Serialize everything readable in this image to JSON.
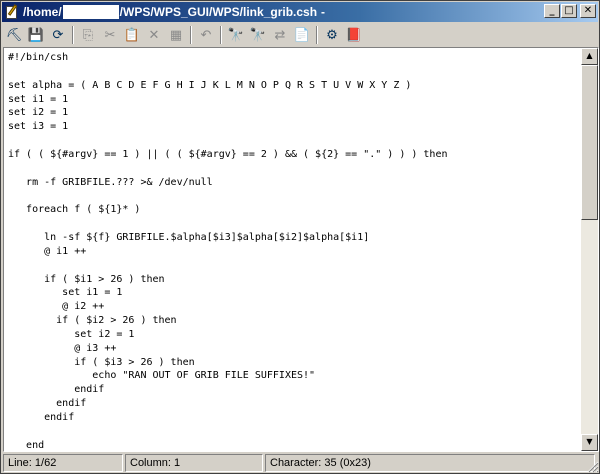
{
  "window": {
    "title_prefix": "/home/",
    "title_suffix": "/WPS/WPS_GUI/WPS/link_grib.csh",
    "title_tail": "-",
    "controls": {
      "minimize": "_",
      "maximize": "□",
      "close": "✕"
    }
  },
  "toolbar": {
    "buttons": [
      {
        "name": "tool-icon",
        "glyph": "⛏",
        "enabled": true
      },
      {
        "name": "save-icon",
        "glyph": "💾",
        "enabled": false
      },
      {
        "name": "reload-icon",
        "glyph": "⟳",
        "enabled": true
      },
      {
        "name": "copy-icon",
        "glyph": "⎘",
        "enabled": false
      },
      {
        "name": "cut-icon",
        "glyph": "✂",
        "enabled": false
      },
      {
        "name": "paste-icon",
        "glyph": "📋",
        "enabled": false
      },
      {
        "name": "delete-icon",
        "glyph": "✕",
        "enabled": false
      },
      {
        "name": "select-all-icon",
        "glyph": "▦",
        "enabled": false
      },
      {
        "name": "undo-icon",
        "glyph": "↶",
        "enabled": false
      },
      {
        "name": "find-icon",
        "glyph": "🔭",
        "enabled": true
      },
      {
        "name": "find-next-icon",
        "glyph": "🔭",
        "enabled": true
      },
      {
        "name": "replace-icon",
        "glyph": "⇄",
        "enabled": false
      },
      {
        "name": "goto-icon",
        "glyph": "📄",
        "enabled": true
      },
      {
        "name": "settings-icon",
        "glyph": "⚙",
        "enabled": true
      },
      {
        "name": "help-icon",
        "glyph": "📕",
        "enabled": true
      }
    ]
  },
  "editor": {
    "lines": [
      "#!/bin/csh",
      "",
      "set alpha = ( A B C D E F G H I J K L M N O P Q R S T U V W X Y Z )",
      "set i1 = 1",
      "set i2 = 1",
      "set i3 = 1",
      "",
      "if ( ( ${#argv} == 1 ) || ( ( ${#argv} == 2 ) && ( ${2} == \".\" ) ) ) then",
      "",
      "   rm -f GRIBFILE.??? >& /dev/null",
      "",
      "   foreach f ( ${1}* )",
      "",
      "      ln -sf ${f} GRIBFILE.$alpha[$i3]$alpha[$i2]$alpha[$i1]",
      "      @ i1 ++",
      "",
      "      if ( $i1 > 26 ) then",
      "         set i1 = 1",
      "         @ i2 ++",
      "        if ( $i2 > 26 ) then",
      "           set i2 = 1",
      "           @ i3 ++",
      "           if ( $i3 > 26 ) then",
      "              echo \"RAN OUT OF GRIB FILE SUFFIXES!\"",
      "           endif",
      "        endif",
      "      endif",
      "",
      "   end"
    ]
  },
  "scrollbar": {
    "up": "▲",
    "down": "▼",
    "thumb_start": 0.0,
    "thumb_fraction": 0.42
  },
  "status": {
    "line": "Line: 1/62",
    "column": "Column: 1",
    "character": "Character: 35 (0x23)"
  }
}
